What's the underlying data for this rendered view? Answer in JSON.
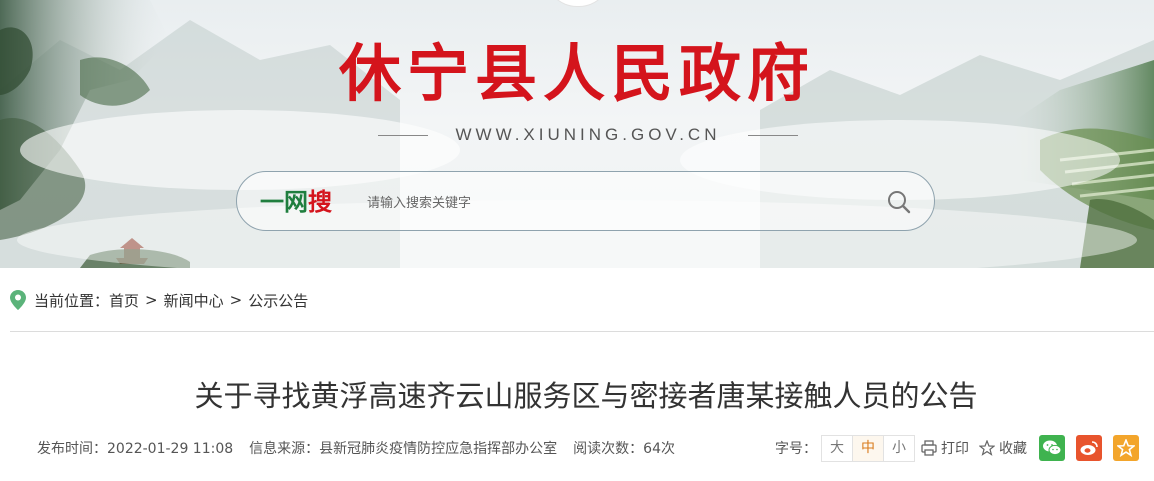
{
  "header": {
    "site_title": "休宁县人民政府",
    "site_url": "WWW.XIUNING.GOV.CN"
  },
  "search": {
    "brand_green": "一网",
    "brand_red": "搜",
    "placeholder": "请输入搜索关键字",
    "button_icon": "search-icon"
  },
  "breadcrumb": {
    "prefix": "当前位置：",
    "items": [
      "首页",
      "新闻中心",
      "公示公告"
    ],
    "separator": ">"
  },
  "article": {
    "title": "关于寻找黄浮高速齐云山服务区与密接者唐某接触人员的公告",
    "publish_time": "发布时间：2022-01-29 11:08",
    "source": "信息来源：县新冠肺炎疫情防控应急指挥部办公室",
    "views": "阅读次数：64次"
  },
  "tools": {
    "font_size_label": "字号：",
    "font_sizes": [
      "大",
      "中",
      "小"
    ],
    "font_size_selected": "中",
    "print_label": "打印",
    "favorite_label": "收藏",
    "share_icons": [
      "wechat-icon",
      "weibo-icon",
      "favorite-star-icon"
    ]
  },
  "colors": {
    "brand_red": "#d4141c",
    "brand_green": "#1f7e3e",
    "active_orange": "#d97b1c",
    "wechat": "#3fb34f",
    "weibo": "#e8542d",
    "fav": "#f3a52b"
  }
}
